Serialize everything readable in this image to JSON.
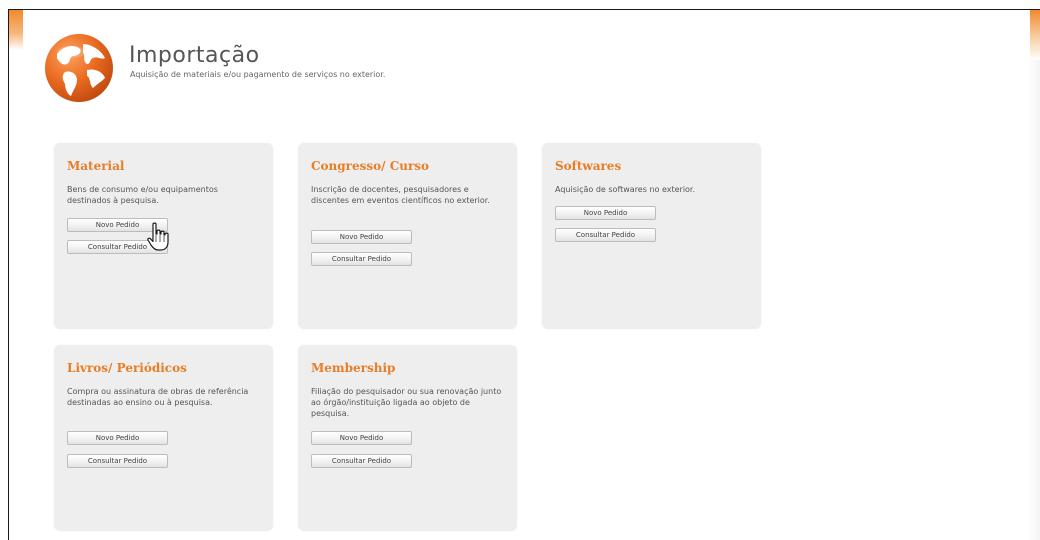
{
  "header": {
    "title": "Importação",
    "subtitle": "Aquisição de materiais e/ou pagamento de serviços no exterior."
  },
  "cards": [
    {
      "title": "Material",
      "description": "Bens de consumo e/ou equipamentos destinados à pesquisa.",
      "new_label": "Novo Pedido",
      "query_label": "Consultar Pedido"
    },
    {
      "title": "Congresso/ Curso",
      "description": "Inscrição de docentes, pesquisadores e discentes em eventos científicos no exterior.",
      "new_label": "Novo Pedido",
      "query_label": "Consultar Pedido"
    },
    {
      "title": "Softwares",
      "description": "Aquisição de softwares no exterior.",
      "new_label": "Novo Pedido",
      "query_label": "Consultar Pedido"
    },
    {
      "title": "Livros/ Periódicos",
      "description": "Compra ou assinatura de obras de referência destinadas ao ensino ou à pesquisa.",
      "new_label": "Novo Pedido",
      "query_label": "Consultar Pedido"
    },
    {
      "title": "Membership",
      "description": "Filiação do pesquisador ou sua renovação junto ao órgão/instituição ligada ao objeto de pesquisa.",
      "new_label": "Novo Pedido",
      "query_label": "Consultar Pedido"
    }
  ],
  "icons": {
    "logo": "globe-icon",
    "cursor": "hand-pointer-icon"
  },
  "colors": {
    "accent": "#e87d26",
    "card_bg": "#eeeeee",
    "globe": "#e8601c"
  }
}
